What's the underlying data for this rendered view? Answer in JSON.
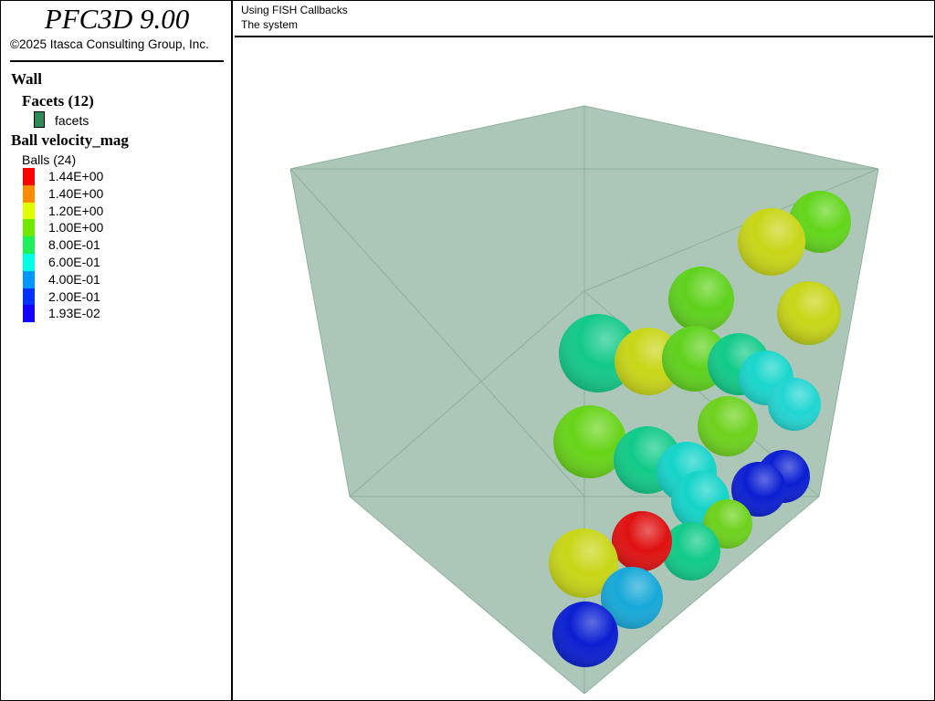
{
  "app": {
    "title": "PFC3D 9.00",
    "copyright": "©2025 Itasca Consulting Group, Inc."
  },
  "legend": {
    "wall_heading": "Wall",
    "facets_heading": "Facets (12)",
    "facets_label": "facets",
    "facet_color": "#2e8b57",
    "ball_heading": "Ball velocity_mag",
    "balls_count": "Balls (24)",
    "scale": [
      {
        "label": "1.44E+00",
        "color": "#ff0000"
      },
      {
        "label": "1.40E+00",
        "color": "#ff8c00"
      },
      {
        "label": "1.20E+00",
        "color": "#dfff00"
      },
      {
        "label": "1.00E+00",
        "color": "#6fe800"
      },
      {
        "label": "8.00E-01",
        "color": "#1ef05a"
      },
      {
        "label": "6.00E-01",
        "color": "#00ffe6"
      },
      {
        "label": "4.00E-01",
        "color": "#0096ff"
      },
      {
        "label": "2.00E-01",
        "color": "#0032ff"
      },
      {
        "label": "1.93E-02",
        "color": "#1400ff"
      }
    ]
  },
  "view": {
    "title": "Using FISH Callbacks",
    "subtitle": "The system"
  },
  "scene": {
    "box_fill": "#a8c4b4",
    "edge_color": "#8fb09d",
    "balls": [
      {
        "value": 0.8,
        "color": "#62d61a"
      },
      {
        "value": 1.15,
        "color": "#c8d616"
      },
      {
        "value": 1.1,
        "color": "#b9d11a"
      },
      {
        "value": 0.8,
        "color": "#5fd21c"
      },
      {
        "value": 1.15,
        "color": "#c8d616"
      },
      {
        "value": 0.65,
        "color": "#12c98a"
      },
      {
        "value": 1.15,
        "color": "#c8d616"
      },
      {
        "value": 0.8,
        "color": "#5fd21c"
      },
      {
        "value": 0.62,
        "color": "#10cb88"
      },
      {
        "value": 0.5,
        "color": "#18d6cc"
      },
      {
        "value": 0.5,
        "color": "#20d6d2"
      },
      {
        "value": 0.85,
        "color": "#6dd21c"
      },
      {
        "value": 0.85,
        "color": "#67d417"
      },
      {
        "value": 0.62,
        "color": "#10cb88"
      },
      {
        "value": 0.5,
        "color": "#14d4c9"
      },
      {
        "value": 0.02,
        "color": "#0a1ed2"
      },
      {
        "value": 0.02,
        "color": "#0a1ed2"
      },
      {
        "value": 0.5,
        "color": "#14d4c9"
      },
      {
        "value": 0.85,
        "color": "#6dd21c"
      },
      {
        "value": 0.62,
        "color": "#10cb88"
      },
      {
        "value": 1.44,
        "color": "#e01010"
      },
      {
        "value": 1.15,
        "color": "#c8d616"
      },
      {
        "value": 0.35,
        "color": "#16a8d8"
      },
      {
        "value": 0.02,
        "color": "#0a1ed2"
      }
    ]
  }
}
